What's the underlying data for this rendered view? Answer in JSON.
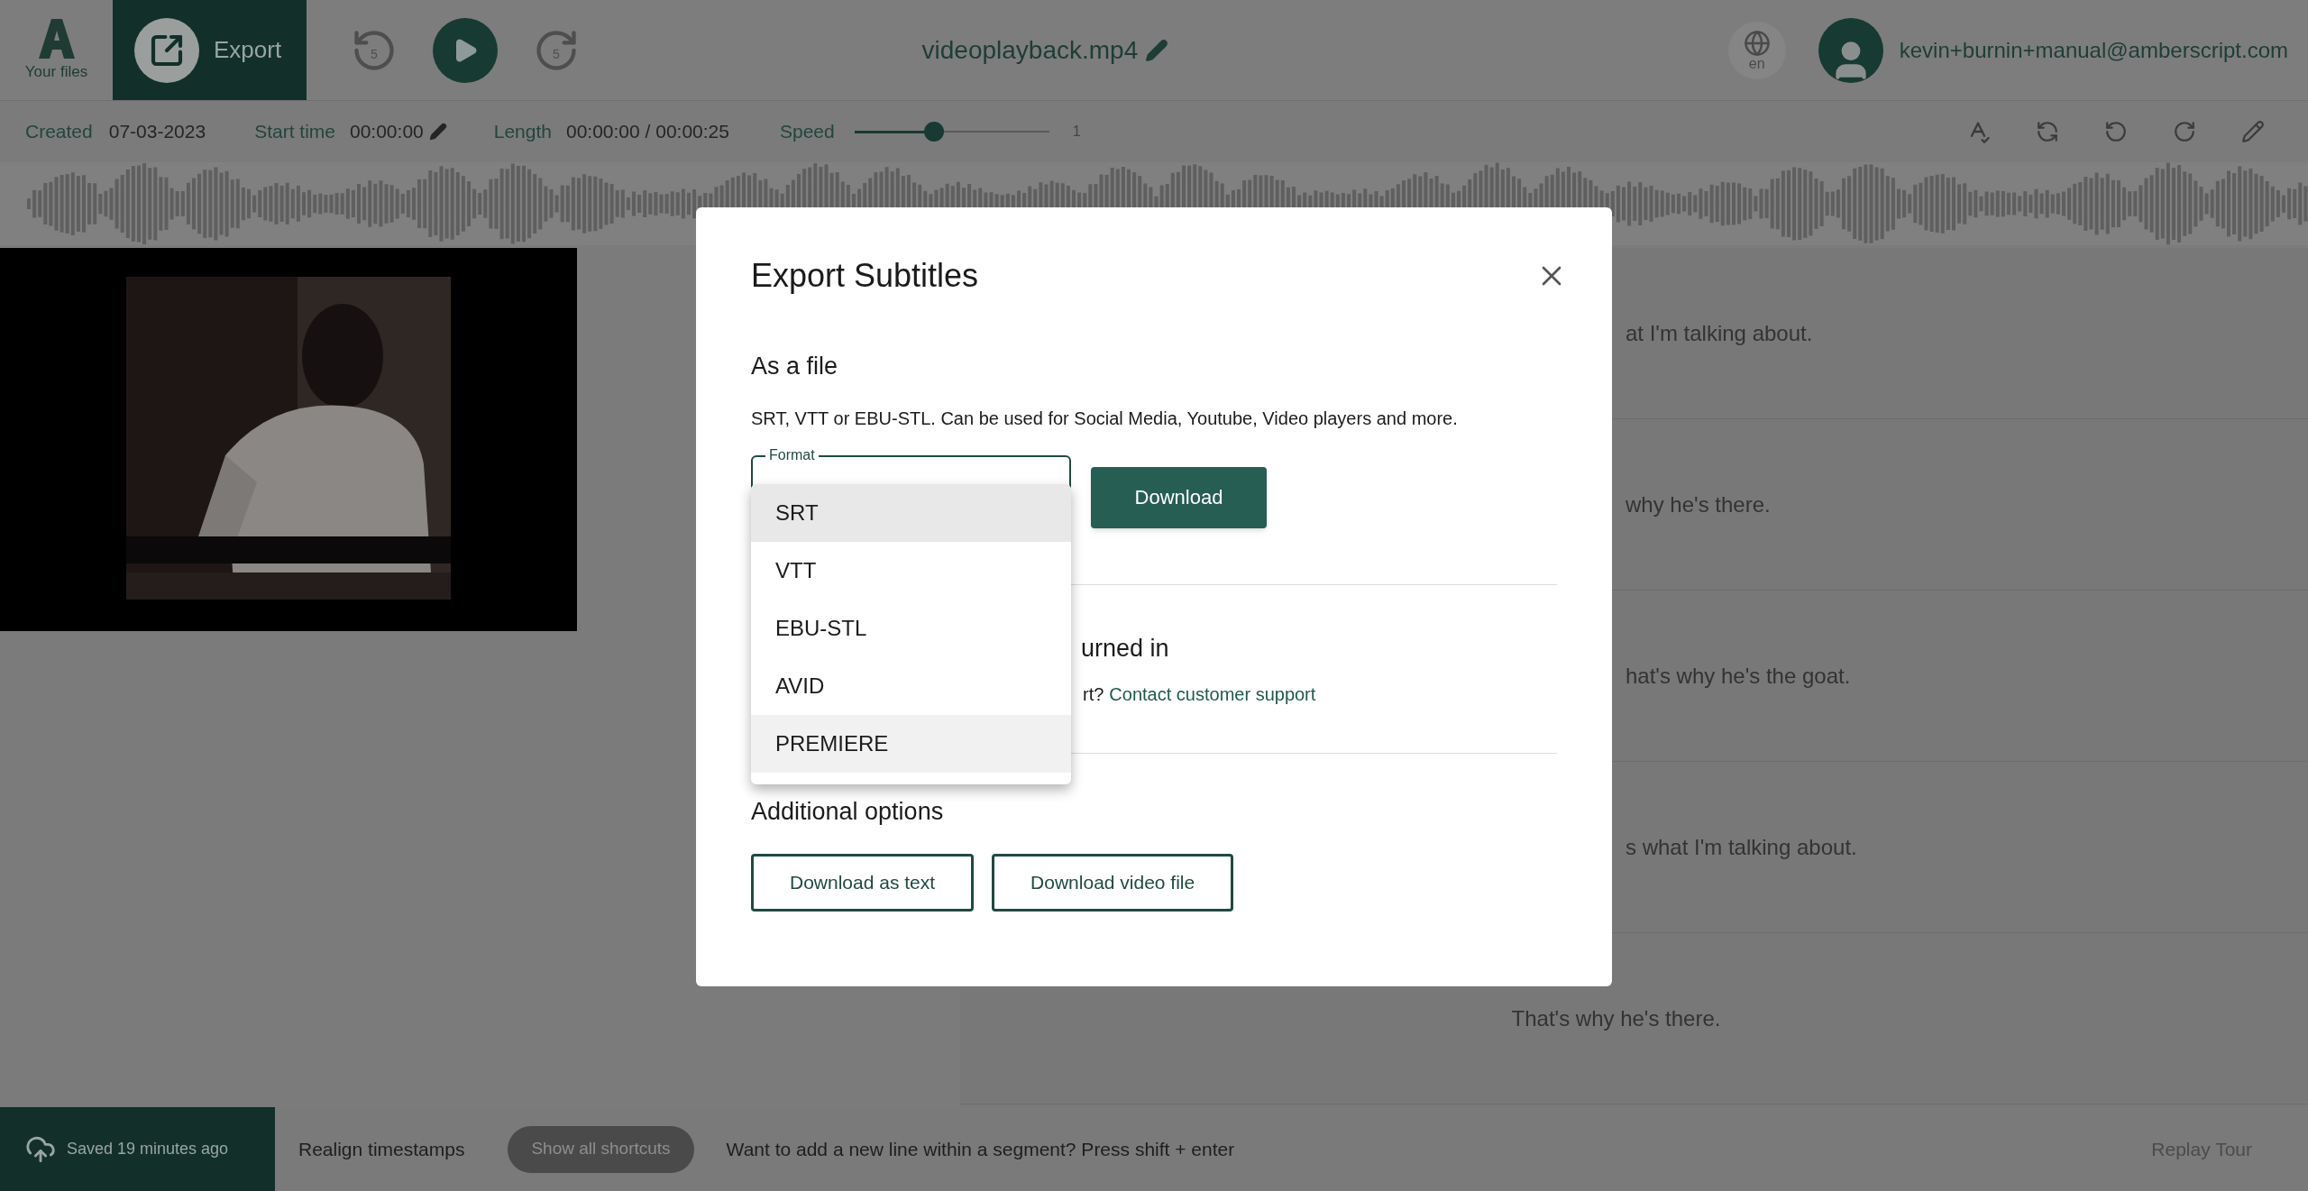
{
  "header": {
    "logo_label": "Your files",
    "export_label": "Export",
    "rewind_label": "5",
    "forward_label": "5",
    "file_title": "videoplayback.mp4",
    "language": "en",
    "user_email": "kevin+burnin+manual@amberscript.com"
  },
  "meta": {
    "created_label": "Created",
    "created": "07-03-2023",
    "start_label": "Start time",
    "start": "00:00:00",
    "length_label": "Length",
    "length": "00:00:00 / 00:00:25",
    "speed": {
      "label": "Speed",
      "level": 0.41,
      "reading": "1"
    }
  },
  "transcript": [
    {
      "text": "at I'm talking about.",
      "kind": "partial"
    },
    {
      "text": "why he's there.",
      "kind": "partial"
    },
    {
      "text": "hat's why he's the goat.",
      "kind": "partial"
    },
    {
      "text": "s what I'm talking about.",
      "kind": "partial"
    },
    {
      "text": "That's why he's there.",
      "kind": "full"
    }
  ],
  "modal": {
    "title": "Export Subtitles",
    "file_section": {
      "heading": "As a file",
      "description": "SRT, VTT or EBU-STL. Can be used for Social Media, Youtube, Video players and more.",
      "format_label": "Format",
      "options": [
        {
          "label": "SRT",
          "selected": true,
          "hovered": false
        },
        {
          "label": "VTT",
          "selected": false,
          "hovered": false
        },
        {
          "label": "EBU-STL",
          "selected": false,
          "hovered": false
        },
        {
          "label": "AVID",
          "selected": false,
          "hovered": false
        },
        {
          "label": "PREMIERE",
          "selected": false,
          "hovered": true
        }
      ],
      "download": "Download"
    },
    "burn_section": {
      "heading": "urned in",
      "text": "rt?",
      "link": "Contact customer support"
    },
    "additional": {
      "heading": "Additional options",
      "buttons": [
        "Download as text",
        "Download video file"
      ]
    }
  },
  "footer": {
    "saved": "Saved 19 minutes ago",
    "realign": "Realign timestamps",
    "shortcuts": "Show all shortcuts",
    "hint": "Want to add a new line within a segment? Press shift + enter",
    "replay": "Replay Tour"
  }
}
